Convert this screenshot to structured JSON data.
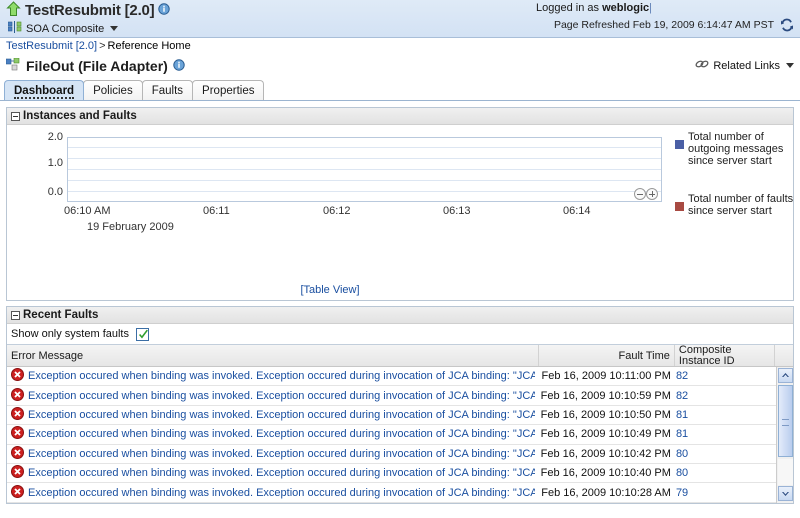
{
  "topbar": {
    "app_title": "TestResubmit [2.0]",
    "info_icon": "info-icon",
    "home_icon": "green-up-arrow-icon",
    "composite_icon": "soa-composite-icon",
    "composite_label": "SOA Composite",
    "logged_in_prefix": "Logged in as",
    "logged_in_user": "weblogic",
    "refreshed_text": "Page Refreshed Feb 19, 2009 6:14:47 AM PST",
    "refresh_icon": "refresh-icon"
  },
  "breadcrumb": {
    "root": "TestResubmit [2.0]",
    "separator": ">",
    "current": "Reference Home"
  },
  "page": {
    "title": "FileOut (File Adapter)",
    "title_icon": "reference-adapter-icon",
    "info_icon": "info-icon",
    "related_links_label": "Related Links",
    "related_links_icon": "chain-link-icon"
  },
  "tabs": [
    {
      "label": "Dashboard",
      "active": true
    },
    {
      "label": "Policies",
      "active": false
    },
    {
      "label": "Faults",
      "active": false
    },
    {
      "label": "Properties",
      "active": false
    }
  ],
  "instances_panel": {
    "header": "Instances and Faults",
    "table_view_link": "[Table View]",
    "zoom_out_icon": "zoom-out-icon",
    "zoom_in_icon": "zoom-in-icon"
  },
  "chart_data": {
    "type": "line",
    "title": "Instances and Faults",
    "xlabel": "19 February 2009",
    "ylabel": "",
    "x": [
      "06:10 AM",
      "06:11",
      "06:12",
      "06:13",
      "06:14"
    ],
    "ytick_labels": [
      "0.0",
      "1.0",
      "2.0"
    ],
    "ylim": [
      0,
      2.4
    ],
    "grid": true,
    "legend_position": "right",
    "series": [
      {
        "name": "Total number of outgoing messages since server start",
        "color": "#4a5fa5",
        "values": [
          0,
          0,
          0,
          0,
          0
        ]
      },
      {
        "name": "Total number of faults since server start",
        "color": "#a84a42",
        "values": [
          0,
          0,
          0,
          0,
          0
        ]
      }
    ]
  },
  "faults_panel": {
    "header": "Recent Faults",
    "system_faults_label": "Show only system faults",
    "system_faults_checked": true,
    "columns": [
      "Error Message",
      "Fault Time",
      "Composite Instance ID"
    ],
    "rows": [
      {
        "icon": "error-icon",
        "message": "Exception occured when binding was invoked. Exception occured during invocation of JCA binding: \"JCA",
        "time": "Feb 16, 2009 10:11:00 PM",
        "instance_id": "82"
      },
      {
        "icon": "error-icon",
        "message": "Exception occured when binding was invoked. Exception occured during invocation of JCA binding: \"JCA",
        "time": "Feb 16, 2009 10:10:59 PM",
        "instance_id": "82"
      },
      {
        "icon": "error-icon",
        "message": "Exception occured when binding was invoked. Exception occured during invocation of JCA binding: \"JCA",
        "time": "Feb 16, 2009 10:10:50 PM",
        "instance_id": "81"
      },
      {
        "icon": "error-icon",
        "message": "Exception occured when binding was invoked. Exception occured during invocation of JCA binding: \"JCA",
        "time": "Feb 16, 2009 10:10:49 PM",
        "instance_id": "81"
      },
      {
        "icon": "error-icon",
        "message": "Exception occured when binding was invoked. Exception occured during invocation of JCA binding: \"JCA",
        "time": "Feb 16, 2009 10:10:42 PM",
        "instance_id": "80"
      },
      {
        "icon": "error-icon",
        "message": "Exception occured when binding was invoked. Exception occured during invocation of JCA binding: \"JCA",
        "time": "Feb 16, 2009 10:10:40 PM",
        "instance_id": "80"
      },
      {
        "icon": "error-icon",
        "message": "Exception occured when binding was invoked. Exception occured during invocation of JCA binding: \"JCA",
        "time": "Feb 16, 2009 10:10:28 AM",
        "instance_id": "79"
      }
    ]
  }
}
